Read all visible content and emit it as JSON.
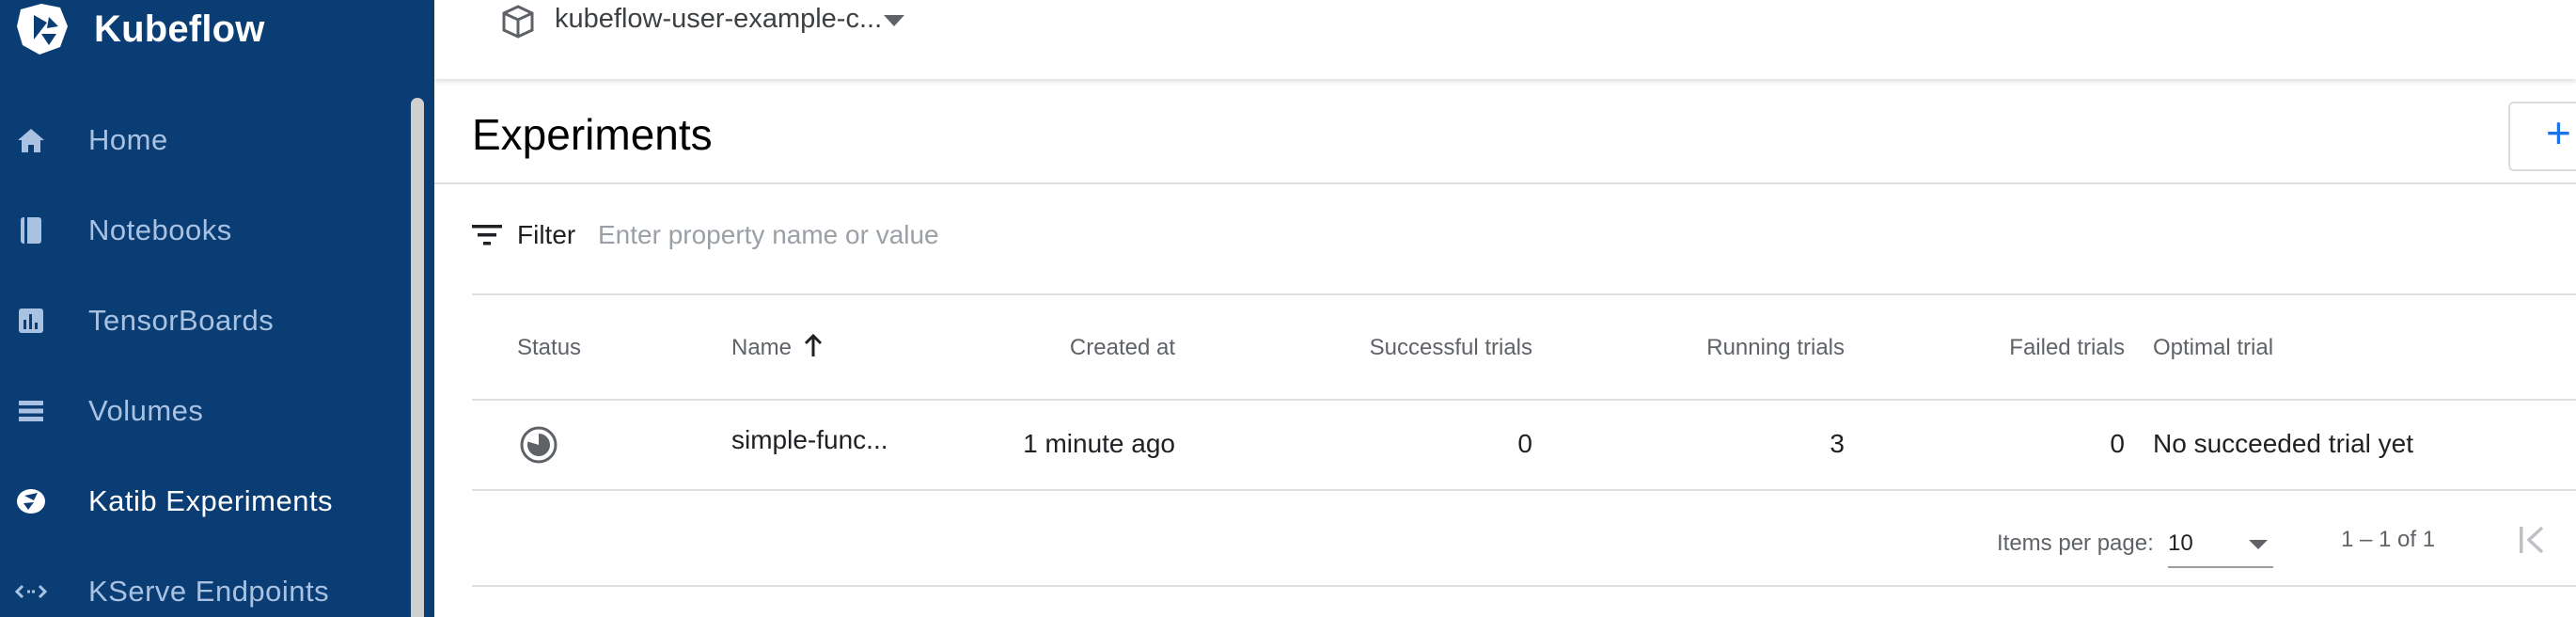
{
  "app": {
    "name": "Kubeflow"
  },
  "sidebar": {
    "items": [
      {
        "label": "Home",
        "icon": "home-icon",
        "active": false
      },
      {
        "label": "Notebooks",
        "icon": "notebook-icon",
        "active": false
      },
      {
        "label": "TensorBoards",
        "icon": "tensorboard-icon",
        "active": false
      },
      {
        "label": "Volumes",
        "icon": "volumes-icon",
        "active": false
      },
      {
        "label": "Katib Experiments",
        "icon": "katib-icon",
        "active": true
      },
      {
        "label": "KServe Endpoints",
        "icon": "kserve-icon",
        "active": false
      }
    ]
  },
  "topbar": {
    "namespace": "kubeflow-user-example-c..."
  },
  "page": {
    "title": "Experiments",
    "new_button": "+"
  },
  "filter": {
    "label": "Filter",
    "placeholder": "Enter property name or value"
  },
  "table": {
    "columns": [
      "Status",
      "Name",
      "Created at",
      "Successful trials",
      "Running trials",
      "Failed trials",
      "Optimal trial"
    ],
    "rows": [
      {
        "status": "running",
        "name": "simple-func...",
        "created": "1 minute ago",
        "successful": "0",
        "running": "3",
        "failed": "0",
        "optimal": "No succeeded trial yet"
      }
    ]
  },
  "pagination": {
    "label": "Items per page:",
    "page_size": "10",
    "range": "1 – 1 of 1"
  },
  "colors": {
    "sidebar_bg": "#0b3d75",
    "accent": "#1a73e8"
  }
}
